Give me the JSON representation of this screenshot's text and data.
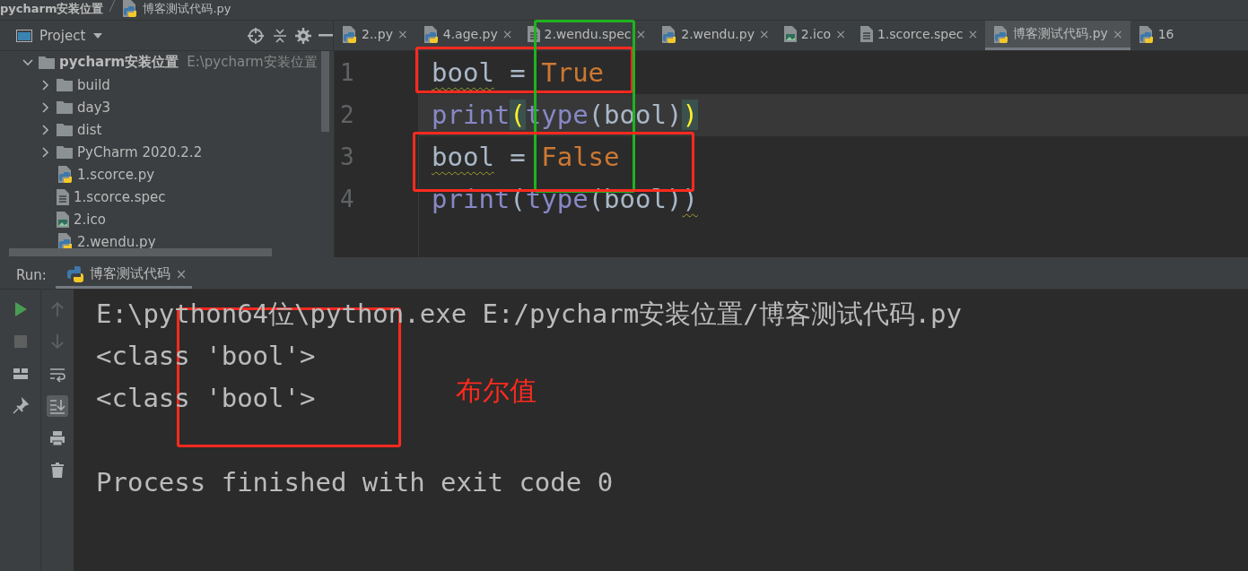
{
  "breadcrumb": [
    {
      "text": "pycharm安装位置",
      "kind": "folder"
    },
    {
      "text": "博客测试代码.py",
      "kind": "py"
    }
  ],
  "project_panel": {
    "title": "Project"
  },
  "tree": {
    "name": "pycharm安装位置",
    "path": "E:\\pycharm安装位置",
    "expanded": true,
    "children": [
      {
        "name": "build",
        "kind": "folder",
        "expanded": false
      },
      {
        "name": "day3",
        "kind": "folder",
        "expanded": false
      },
      {
        "name": "dist",
        "kind": "folder",
        "expanded": false
      },
      {
        "name": "PyCharm 2020.2.2",
        "kind": "folder",
        "expanded": false
      },
      {
        "name": "1.scorce.py",
        "kind": "py"
      },
      {
        "name": "1.scorce.spec",
        "kind": "spec"
      },
      {
        "name": "2.ico",
        "kind": "ico"
      },
      {
        "name": "2.wendu.py",
        "kind": "py"
      }
    ]
  },
  "editor_tabs": [
    {
      "label": "2..py",
      "kind": "py",
      "selected": false,
      "close": "×"
    },
    {
      "label": "4.age.py",
      "kind": "py",
      "selected": false,
      "close": "×"
    },
    {
      "label": "2.wendu.spec",
      "kind": "spec",
      "selected": false,
      "close": "×"
    },
    {
      "label": "2.wendu.py",
      "kind": "py",
      "selected": false,
      "close": "×"
    },
    {
      "label": "2.ico",
      "kind": "ico",
      "selected": false,
      "close": "×"
    },
    {
      "label": "1.scorce.spec",
      "kind": "spec",
      "selected": false,
      "close": "×"
    },
    {
      "label": "博客测试代码.py",
      "kind": "py",
      "selected": true,
      "close": "×"
    },
    {
      "label": "16",
      "kind": "py",
      "selected": false
    }
  ],
  "code_lines": [
    {
      "number": "1",
      "current": false,
      "tokens": [
        {
          "kind": "warn",
          "text": "bool"
        },
        {
          "kind": "plain",
          "text": " = "
        },
        {
          "kind": "keyword",
          "text": "True"
        }
      ]
    },
    {
      "number": "2",
      "current": true,
      "tokens": [
        {
          "kind": "builtin",
          "text": "print"
        },
        {
          "kind": "brace-match",
          "text": "("
        },
        {
          "kind": "builtin",
          "text": "type"
        },
        {
          "kind": "plain",
          "text": "(bool)"
        },
        {
          "kind": "brace-match",
          "text": ")"
        }
      ]
    },
    {
      "number": "3",
      "current": false,
      "tokens": [
        {
          "kind": "warn",
          "text": "bool"
        },
        {
          "kind": "plain",
          "text": " = "
        },
        {
          "kind": "keyword",
          "text": "False"
        }
      ]
    },
    {
      "number": "4",
      "current": false,
      "tokens": [
        {
          "kind": "builtin",
          "text": "print"
        },
        {
          "kind": "plain",
          "text": "("
        },
        {
          "kind": "builtin",
          "text": "type"
        },
        {
          "kind": "plain",
          "text": "(bool)"
        },
        {
          "kind": "warn",
          "text": ")"
        }
      ]
    }
  ],
  "run": {
    "label": "Run:",
    "tab": "博客测试代码",
    "close": "×"
  },
  "console_lines": [
    {
      "kind": "output",
      "text": "E:\\python64位\\python.exe E:/pycharm安装位置/博客测试代码.py"
    },
    {
      "kind": "output",
      "text": "<class 'bool'>"
    },
    {
      "kind": "output",
      "text": "<class 'bool'>"
    },
    {
      "kind": "blank"
    },
    {
      "kind": "output",
      "text": "Process finished with exit code 0"
    }
  ],
  "annotations": [
    {
      "kind": "box",
      "color": "#ff2a1f"
    },
    {
      "kind": "box",
      "color": "#1fb31f"
    },
    {
      "kind": "box",
      "color": "#ff2a1f"
    },
    {
      "kind": "box",
      "color": "#ff2a1f"
    },
    {
      "kind": "label",
      "color": "#ff2a1f",
      "text": "布尔值"
    }
  ]
}
